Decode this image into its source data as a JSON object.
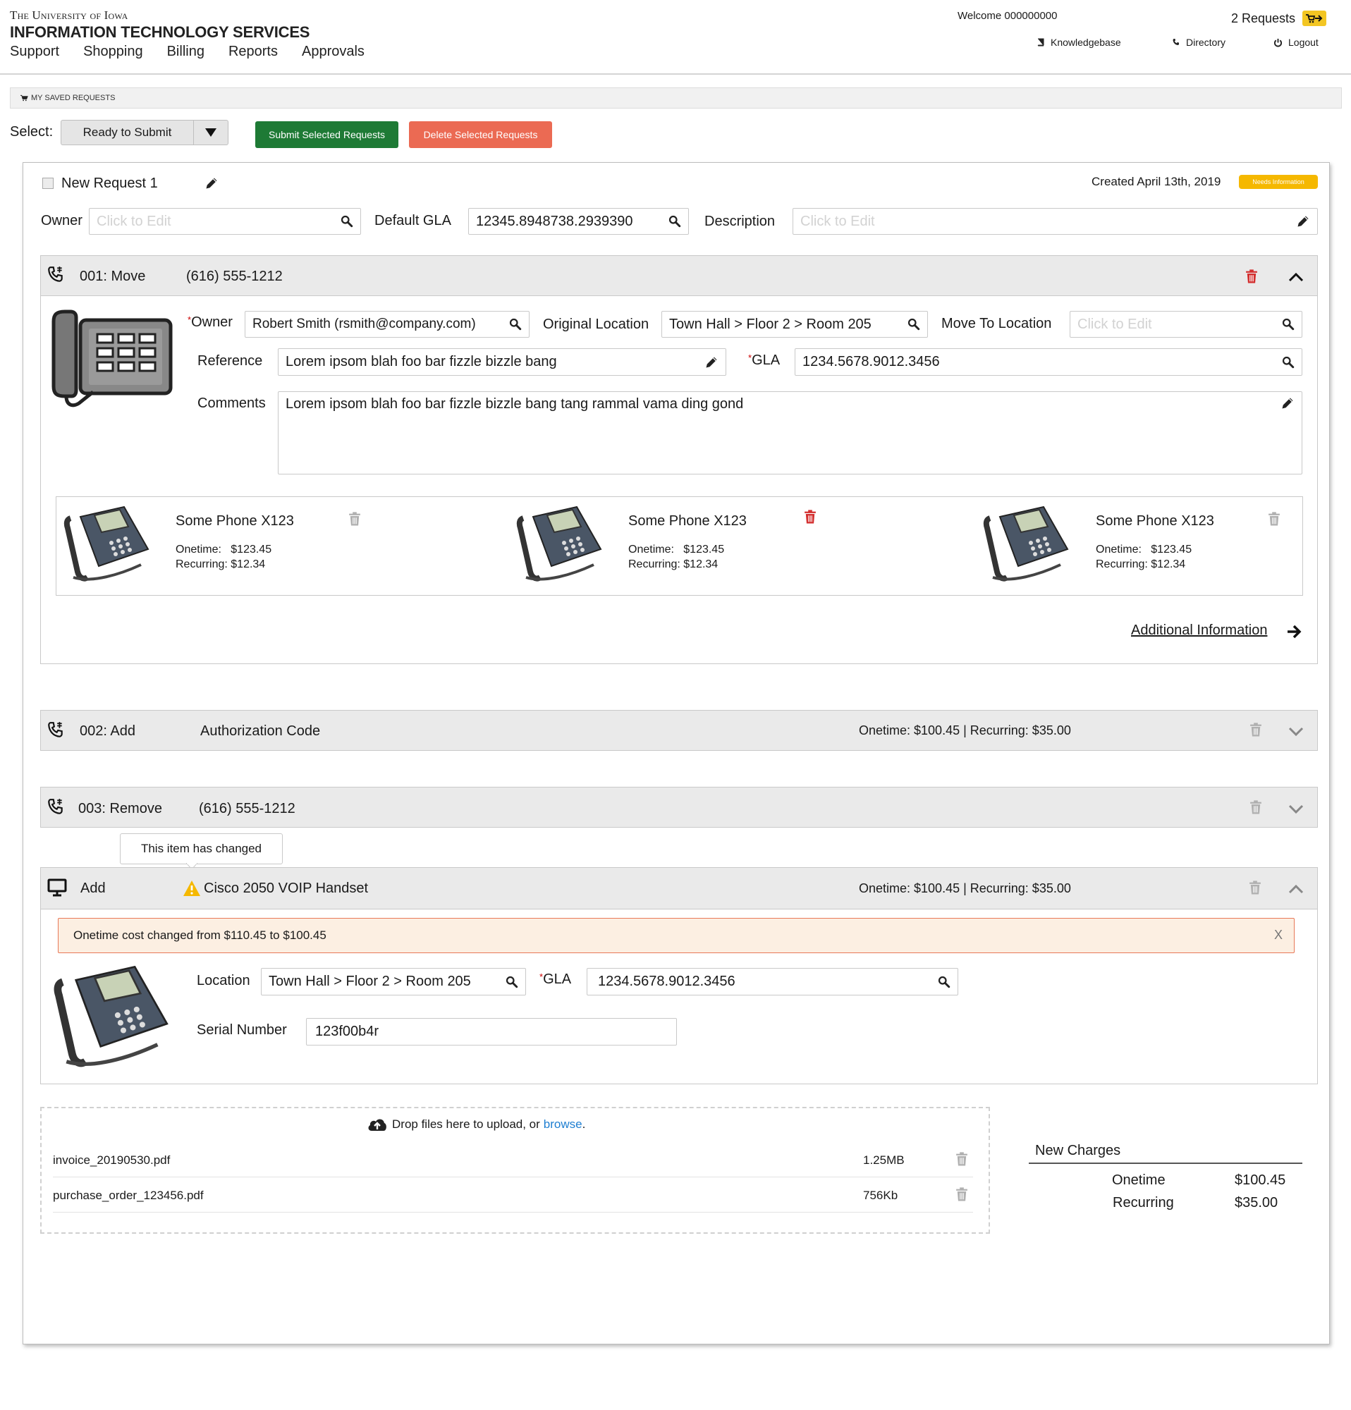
{
  "header": {
    "university": "The University of Iowa",
    "department": "INFORMATION TECHNOLOGY SERVICES",
    "nav": [
      "Support",
      "Shopping",
      "Billing",
      "Reports",
      "Approvals"
    ],
    "welcome": "Welcome 000000000",
    "requests_count": "2 Requests",
    "links": {
      "knowledgebase": "Knowledgebase",
      "directory": "Directory",
      "logout": "Logout"
    }
  },
  "saved_requests_label": "MY SAVED REQUESTS",
  "toolbar": {
    "select_label": "Select:",
    "select_value": "Ready to Submit",
    "submit_label": "Submit Selected Requests",
    "delete_label": "Delete Selected Requests"
  },
  "request": {
    "title": "New Request 1",
    "created": "Created April 13th, 2019",
    "status_badge": "Needs Information",
    "owner_label": "Owner",
    "owner_placeholder": "Click to Edit",
    "default_gla_label": "Default GLA",
    "default_gla_value": "12345.8948738.2939390",
    "description_label": "Description",
    "description_placeholder": "Click to Edit"
  },
  "item1": {
    "code": "001: Move",
    "number": "(616) 555-1212",
    "owner_label": "Owner",
    "owner_value": "Robert Smith (rsmith@company.com)",
    "orig_loc_label": "Original Location",
    "orig_loc_value": "Town Hall > Floor 2 > Room 205",
    "move_to_label": "Move To Location",
    "move_to_placeholder": "Click to Edit",
    "reference_label": "Reference",
    "reference_value": "Lorem ipsom blah foo bar fizzle bizzle bang",
    "gla_label": "GLA",
    "gla_value": "1234.5678.9012.3456",
    "comments_label": "Comments",
    "comments_value": "Lorem ipsom blah foo bar fizzle bizzle bang tang rammal vama ding gond",
    "phones": [
      {
        "name": "Some Phone X123",
        "onetime_label": "Onetime:",
        "onetime": "$123.45",
        "recurring_label": "Recurring:",
        "recurring": "$12.34"
      },
      {
        "name": "Some Phone X123",
        "onetime_label": "Onetime:",
        "onetime": "$123.45",
        "recurring_label": "Recurring:",
        "recurring": "$12.34"
      },
      {
        "name": "Some Phone X123",
        "onetime_label": "Onetime:",
        "onetime": "$123.45",
        "recurring_label": "Recurring:",
        "recurring": "$12.34"
      }
    ],
    "additional_info": "Additional Information"
  },
  "item2": {
    "code": "002:  Add",
    "desc": "Authorization Code",
    "costs": "Onetime: $100.45 | Recurring: $35.00"
  },
  "item3": {
    "code": "003:  Remove",
    "number": "(616) 555-1212",
    "tooltip": "This item has changed"
  },
  "item4": {
    "action": "Add",
    "desc": "Cisco 2050 VOIP Handset",
    "costs": "Onetime: $100.45 | Recurring: $35.00",
    "alert": "Onetime cost changed from $110.45 to $100.45",
    "alert_close": "X",
    "location_label": "Location",
    "location_value": "Town Hall > Floor 2 > Room 205",
    "gla_label": "GLA",
    "gla_value": "1234.5678.9012.3456",
    "serial_label": "Serial Number",
    "serial_value": "123f00b4r"
  },
  "upload": {
    "prompt": "Drop files here to upload, or",
    "browse": "browse",
    "period": ".",
    "files": [
      {
        "name": "invoice_20190530.pdf",
        "size": "1.25MB"
      },
      {
        "name": "purchase_order_123456.pdf",
        "size": "756Kb"
      }
    ]
  },
  "charges": {
    "title": "New Charges",
    "onetime_label": "Onetime",
    "onetime_value": "$100.45",
    "recurring_label": "Recurring",
    "recurring_value": "$35.00"
  },
  "required_mark": "*",
  "colors": {
    "green": "#1e7a35",
    "red_button": "#eb6a53",
    "badge": "#f5b800",
    "cart": "#f3c623",
    "trash_active": "#d32f2f",
    "trash_muted": "#b0b0b0",
    "link": "#1f7fd1"
  }
}
